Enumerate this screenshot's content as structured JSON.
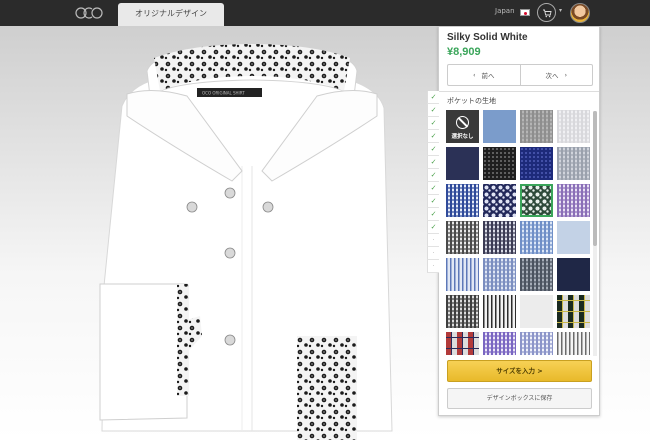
{
  "topbar": {
    "tab_label": "オリジナルデザイン",
    "region": "Japan",
    "icons": {
      "logo": "oco-logo",
      "flag": "japan-flag-icon",
      "cart": "cart-icon",
      "avatar": "user-avatar"
    }
  },
  "product": {
    "name": "Silky Solid White",
    "price": "¥8,909"
  },
  "nav": {
    "prev_label": "前へ",
    "next_label": "次へ",
    "prev_icon": "‹",
    "next_icon": "›"
  },
  "section": {
    "label": "ポケットの生地",
    "none_label": "選択なし"
  },
  "checklist": [
    "✓",
    "✓",
    "✓",
    "✓",
    "✓",
    "✓",
    "✓",
    "✓",
    "✓",
    "✓",
    "✓",
    "·",
    "·",
    "·"
  ],
  "swatches": [
    {
      "type": "none",
      "color": "#3a3a3a"
    },
    {
      "type": "solid",
      "color": "#7b9ccb"
    },
    {
      "type": "check",
      "color": "#8e8e8e",
      "alt": "#b5b5b5"
    },
    {
      "type": "check",
      "color": "#d8d8dc",
      "alt": "#f0f0f3"
    },
    {
      "type": "solid",
      "color": "#2b3156"
    },
    {
      "type": "dots",
      "color": "#1e1e1e",
      "alt": "#6a6a6a"
    },
    {
      "type": "dots",
      "color": "#1d2a7a",
      "alt": "#4a57b0"
    },
    {
      "type": "check",
      "color": "#9aa1ad",
      "alt": "#d0d4dc"
    },
    {
      "type": "check",
      "color": "#2f4a9a",
      "alt": "#e6ecf8"
    },
    {
      "type": "floral",
      "color": "#22285a",
      "alt": "#dfe3f4"
    },
    {
      "type": "floral",
      "color": "#2e4a3a",
      "alt": "#e9f0ec",
      "selected": true
    },
    {
      "type": "check",
      "color": "#8a6fb7",
      "alt": "#e8e1f3"
    },
    {
      "type": "check",
      "color": "#4a4a4a",
      "alt": "#e8e8e8"
    },
    {
      "type": "check",
      "color": "#3b3b54",
      "alt": "#d9dbe6"
    },
    {
      "type": "check",
      "color": "#6f8fc7",
      "alt": "#dbe6f6"
    },
    {
      "type": "solid",
      "color": "#c3d2e6"
    },
    {
      "type": "stripe",
      "color": "#5d78b8",
      "alt": "#e1e8f5"
    },
    {
      "type": "check",
      "color": "#7b8ec0",
      "alt": "#dfe6f4"
    },
    {
      "type": "check",
      "color": "#4b5360",
      "alt": "#a6adb8"
    },
    {
      "type": "solid",
      "color": "#1f2746"
    },
    {
      "type": "check",
      "color": "#3f3f3f",
      "alt": "#dcdcdc"
    },
    {
      "type": "stripe",
      "color": "#2c2c2c",
      "alt": "#f2f2f2"
    },
    {
      "type": "solid",
      "color": "#ececec"
    },
    {
      "type": "tartan",
      "color": "#1a2a20",
      "alt": "#c9b74a"
    },
    {
      "type": "tartan",
      "color": "#b23a3a",
      "alt": "#2a2a5a"
    },
    {
      "type": "check",
      "color": "#7a66c2",
      "alt": "#ece8f7"
    },
    {
      "type": "check",
      "color": "#8c95c9",
      "alt": "#f0f2fa"
    },
    {
      "type": "stripe",
      "color": "#6b6b6b",
      "alt": "#f4f4f4"
    }
  ],
  "actions": {
    "size_label": "サイズを入力 >",
    "save_label": "デザインボックスに保存"
  },
  "colors": {
    "price": "#3aa55a",
    "primary_button": "#f2c94c",
    "topbar": "#2b2b2b"
  }
}
